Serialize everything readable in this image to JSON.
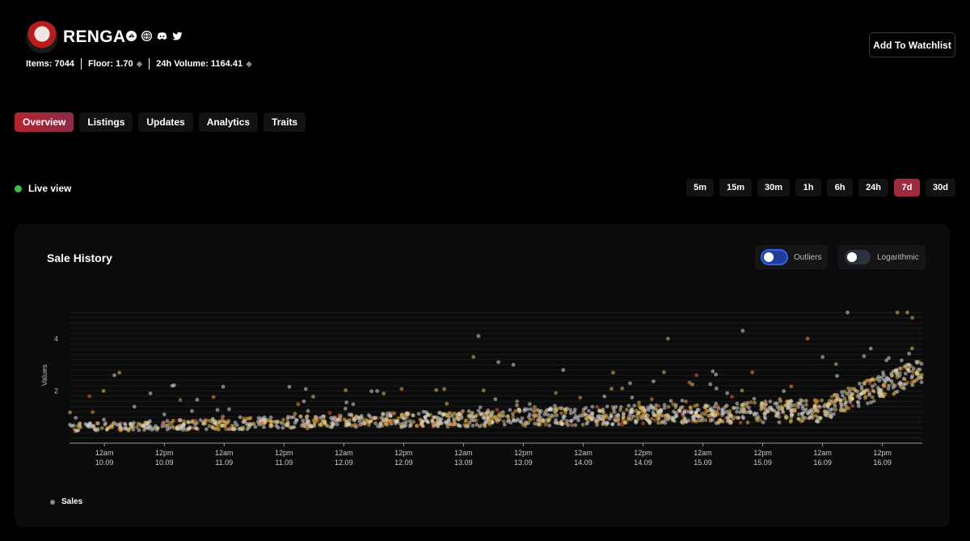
{
  "collection": {
    "name": "RENGA",
    "items_label": "Items: 7044",
    "floor_label": "Floor: 1.70",
    "volume_label": "24h Volume: 1164.41"
  },
  "actions": {
    "watchlist_label": "Add To Watchlist"
  },
  "tabs": [
    {
      "label": "Overview",
      "active": true
    },
    {
      "label": "Listings",
      "active": false
    },
    {
      "label": "Updates",
      "active": false
    },
    {
      "label": "Analytics",
      "active": false
    },
    {
      "label": "Traits",
      "active": false
    }
  ],
  "live": {
    "label": "Live view",
    "color": "#3fb950"
  },
  "ranges": [
    {
      "label": "5m",
      "active": false
    },
    {
      "label": "15m",
      "active": false
    },
    {
      "label": "30m",
      "active": false
    },
    {
      "label": "1h",
      "active": false
    },
    {
      "label": "6h",
      "active": false
    },
    {
      "label": "24h",
      "active": false
    },
    {
      "label": "7d",
      "active": true
    },
    {
      "label": "30d",
      "active": false
    }
  ],
  "panel": {
    "title": "Sale History",
    "toggles": {
      "outliers": {
        "label": "Outliers",
        "on": true
      },
      "logarithmic": {
        "label": "Logarithmic",
        "on": false
      }
    }
  },
  "chart_data": {
    "type": "scatter",
    "title": "Sale History",
    "ylabel": "Values",
    "xlabel": "",
    "ylim": [
      0,
      5.2
    ],
    "yticks": [
      2,
      4
    ],
    "xticks": [
      {
        "time": "12am",
        "date": "10.09"
      },
      {
        "time": "12pm",
        "date": "10.09"
      },
      {
        "time": "12am",
        "date": "11.09"
      },
      {
        "time": "12pm",
        "date": "11.09"
      },
      {
        "time": "12am",
        "date": "12.09"
      },
      {
        "time": "12pm",
        "date": "12.09"
      },
      {
        "time": "12am",
        "date": "13.09"
      },
      {
        "time": "12pm",
        "date": "13.09"
      },
      {
        "time": "12am",
        "date": "14.09"
      },
      {
        "time": "12pm",
        "date": "14.09"
      },
      {
        "time": "12am",
        "date": "15.09"
      },
      {
        "time": "12pm",
        "date": "15.09"
      },
      {
        "time": "12am",
        "date": "16.09"
      },
      {
        "time": "12pm",
        "date": "16.09"
      }
    ],
    "series": [
      {
        "name": "Sales",
        "color": "#888888",
        "point_colors": [
          "#d9d9d9",
          "#e6c15a",
          "#e0a23a",
          "#e8643a"
        ],
        "points": [
          {
            "t": "2022-09-09T21:00",
            "v": 1.8
          },
          {
            "t": "2022-09-10T02:00",
            "v": 2.6
          },
          {
            "t": "2022-09-10T03:00",
            "v": 2.7
          },
          {
            "t": "2022-09-10T06:00",
            "v": 1.4
          },
          {
            "t": "2022-09-10T12:00",
            "v": 1.1
          },
          {
            "t": "2022-09-11T01:00",
            "v": 1.3
          },
          {
            "t": "2022-09-11T16:00",
            "v": 1.6
          },
          {
            "t": "2022-09-12T08:00",
            "v": 1.9
          },
          {
            "t": "2022-09-12T16:00",
            "v": 1.2
          },
          {
            "t": "2022-09-13T02:00",
            "v": 3.3
          },
          {
            "t": "2022-09-13T03:00",
            "v": 4.1
          },
          {
            "t": "2022-09-13T07:00",
            "v": 3.1
          },
          {
            "t": "2022-09-13T10:00",
            "v": 3.0
          },
          {
            "t": "2022-09-13T20:00",
            "v": 2.8
          },
          {
            "t": "2022-09-14T06:00",
            "v": 2.7
          },
          {
            "t": "2022-09-14T17:00",
            "v": 4.0
          },
          {
            "t": "2022-09-15T08:00",
            "v": 4.3
          },
          {
            "t": "2022-09-15T21:00",
            "v": 4.0
          },
          {
            "t": "2022-09-16T00:00",
            "v": 3.3
          },
          {
            "t": "2022-09-16T05:00",
            "v": 5.0
          },
          {
            "t": "2022-09-16T15:00",
            "v": 5.0
          },
          {
            "t": "2022-09-16T17:00",
            "v": 5.0
          },
          {
            "t": "2022-09-16T18:00",
            "v": 4.8
          }
        ],
        "note_density": "dense cluster of sales between 0.3 and 1.2 across all days, rising toward 2-3 on 16.09"
      }
    ],
    "legend": [
      "Sales"
    ],
    "grid": true,
    "legend_position": "bottom-left"
  }
}
